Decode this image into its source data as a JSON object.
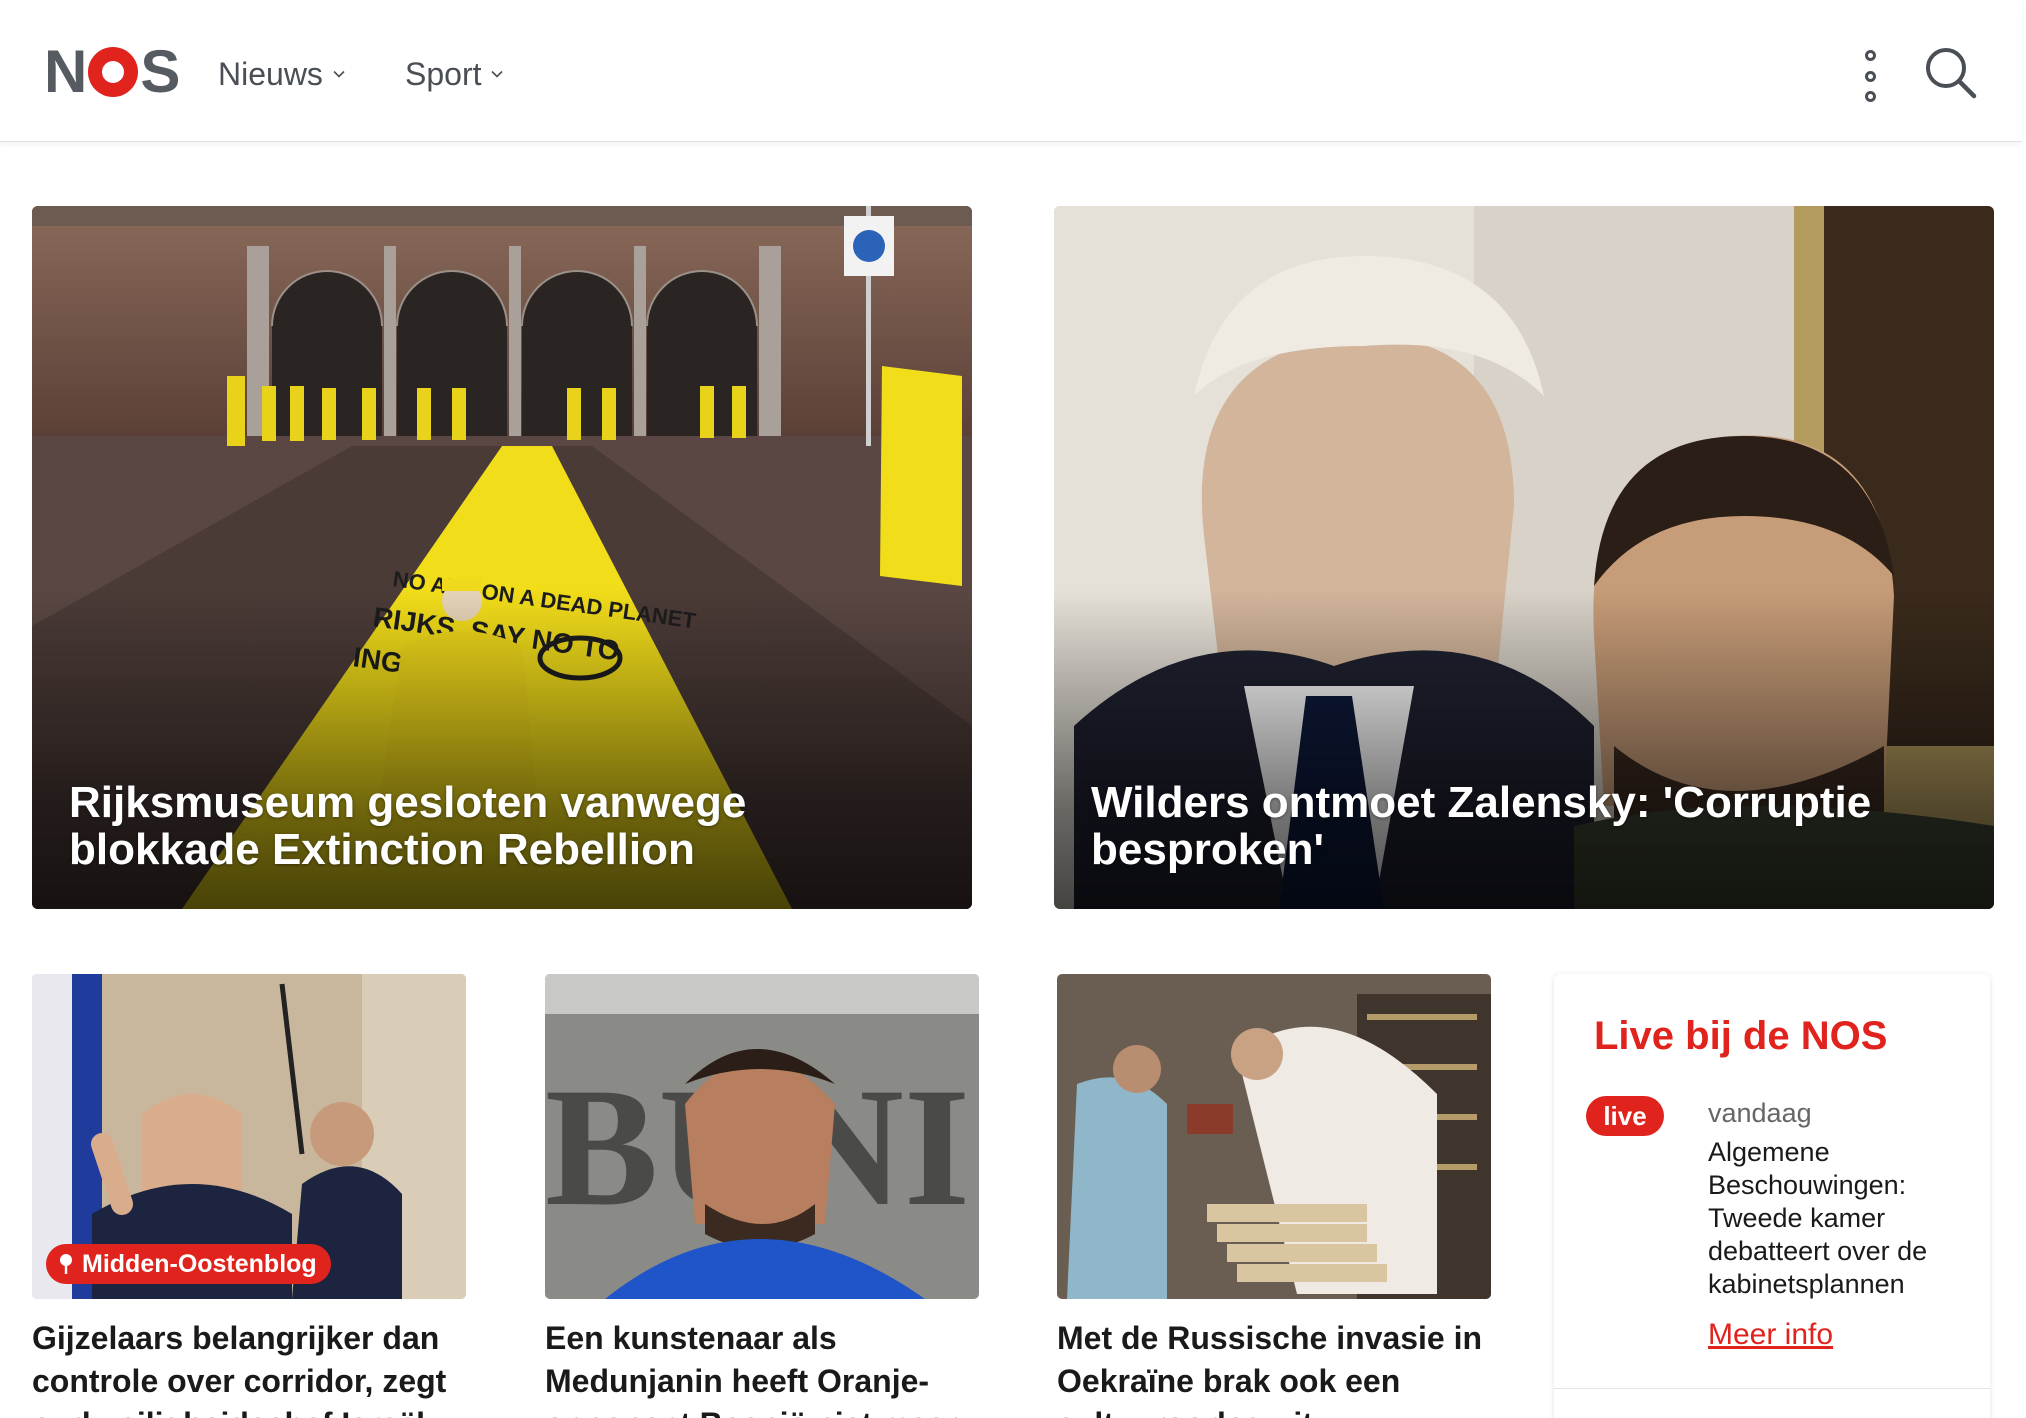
{
  "brand": {
    "logo_text": "NOS",
    "accent": "#e0231d",
    "text_grey": "#565b61"
  },
  "header": {
    "nav": [
      {
        "label": "Nieuws"
      },
      {
        "label": "Sport"
      }
    ],
    "menu_icon": "vertical-dots-icon",
    "search_icon": "search-icon"
  },
  "hero": [
    {
      "title": "Rijksmuseum gesloten vanwege blokkade Extinction Rebellion"
    },
    {
      "title": "Wilders ontmoet Zalensky: 'Corruptie besproken'"
    }
  ],
  "cards": [
    {
      "tag": "Midden-Oostenblog",
      "headline": "Gijzelaars belangrijker dan controle over corridor, zegt oud-veiligheidschef Israël"
    },
    {
      "headline": "Een kunstenaar als Medunjanin heeft Oranje-opponent Bosnië niet meer"
    },
    {
      "headline": "Met de Russische invasie in Oekraïne brak ook een cultuuroorlog uit"
    }
  ],
  "live": {
    "title": "Live bij de NOS",
    "badge": "live",
    "date": "vandaag",
    "text": "Algemene Beschouwingen: Tweede kamer debatteert over de kabinetsplannen",
    "more": "Meer info"
  }
}
